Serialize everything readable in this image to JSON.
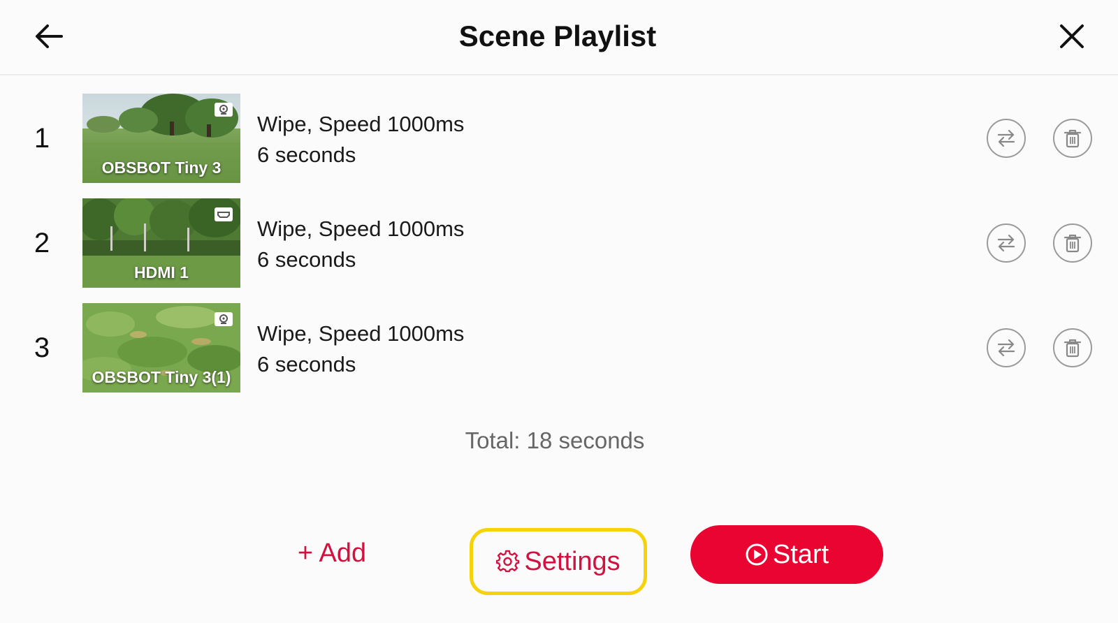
{
  "header": {
    "title": "Scene Playlist",
    "back_icon": "arrow-left-icon",
    "close_icon": "close-icon"
  },
  "scenes": [
    {
      "index": "1",
      "label": "OBSBOT Tiny 3",
      "source_type_icon": "webcam-icon",
      "transition": "Wipe, Speed 1000ms",
      "duration": "6 seconds"
    },
    {
      "index": "2",
      "label": "HDMI 1",
      "source_type_icon": "hdmi-icon",
      "transition": "Wipe, Speed 1000ms",
      "duration": "6 seconds"
    },
    {
      "index": "3",
      "label": "OBSBOT Tiny 3(1)",
      "source_type_icon": "webcam-icon",
      "transition": "Wipe, Speed 1000ms",
      "duration": "6 seconds"
    }
  ],
  "total": "Total: 18 seconds",
  "actions": {
    "add_label": "+ Add",
    "settings_label": "Settings",
    "start_label": "Start"
  },
  "colors": {
    "accent": "#ea0432",
    "accent_text": "#d1123f",
    "highlight": "#f5d20a"
  }
}
